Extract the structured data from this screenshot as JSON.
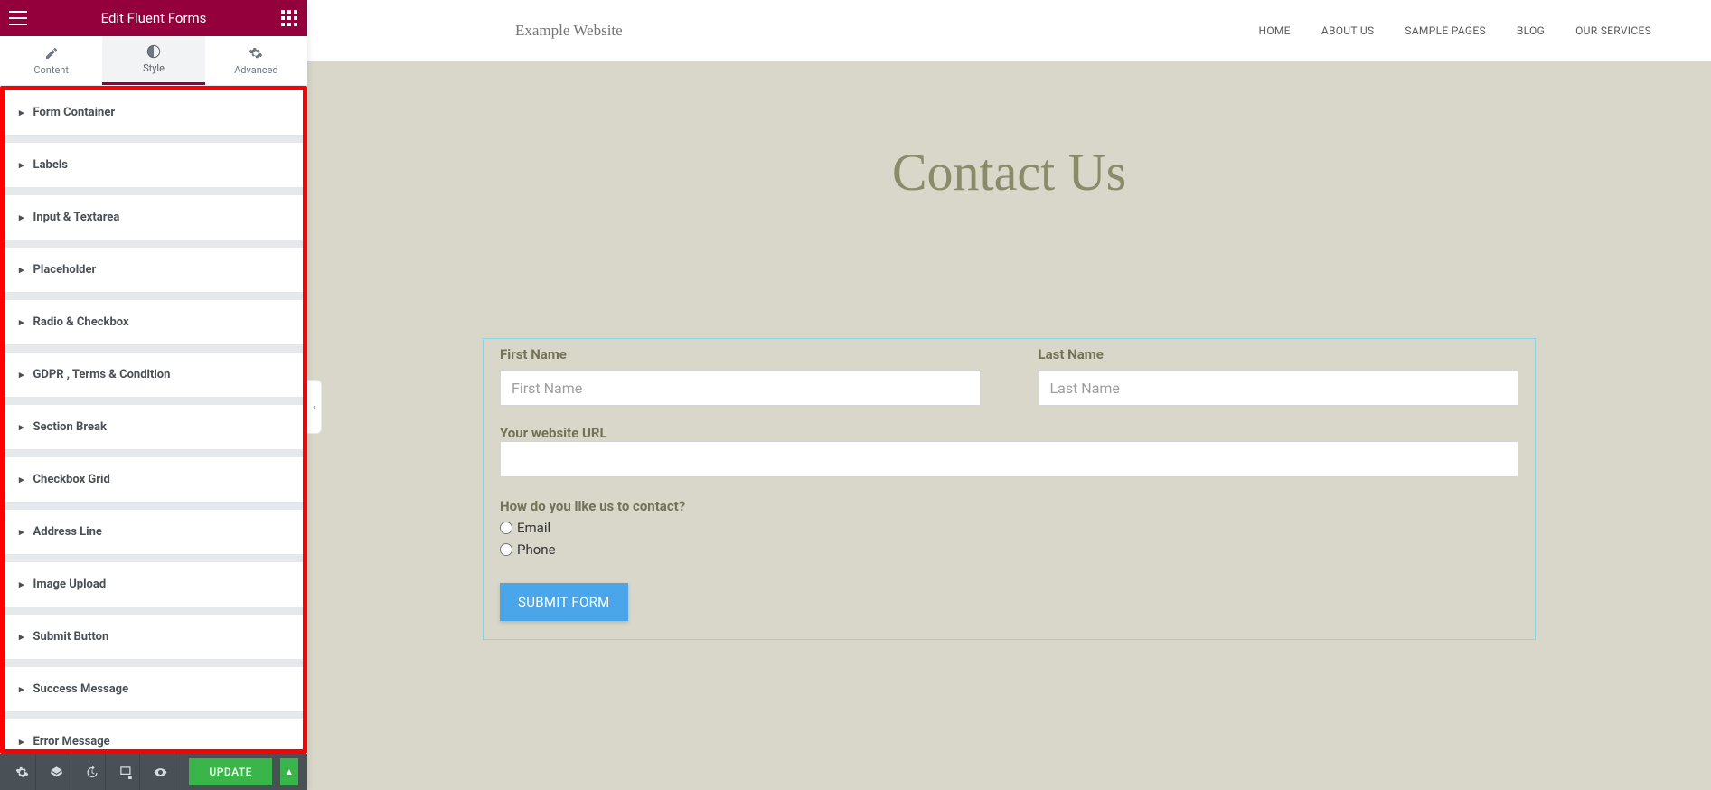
{
  "panel": {
    "title": "Edit Fluent Forms",
    "tabs": {
      "content": "Content",
      "style": "Style",
      "advanced": "Advanced"
    },
    "sections": [
      "Form Container",
      "Labels",
      "Input & Textarea",
      "Placeholder",
      "Radio & Checkbox",
      "GDPR , Terms & Condition",
      "Section Break",
      "Checkbox Grid",
      "Address Line",
      "Image Upload",
      "Submit Button",
      "Success Message",
      "Error Message"
    ],
    "footer": {
      "update": "UPDATE"
    }
  },
  "site": {
    "title": "Example Website",
    "nav": [
      "HOME",
      "ABOUT US",
      "SAMPLE PAGES",
      "BLOG",
      "OUR SERVICES"
    ],
    "heading": "Contact Us"
  },
  "form": {
    "first_name": {
      "label": "First Name",
      "placeholder": "First Name"
    },
    "last_name": {
      "label": "Last Name",
      "placeholder": "Last Name"
    },
    "website": {
      "label": "Your website URL"
    },
    "contact_pref": {
      "label": "How do you like us to contact?",
      "options": [
        "Email",
        "Phone"
      ]
    },
    "submit": "SUBMIT FORM"
  }
}
